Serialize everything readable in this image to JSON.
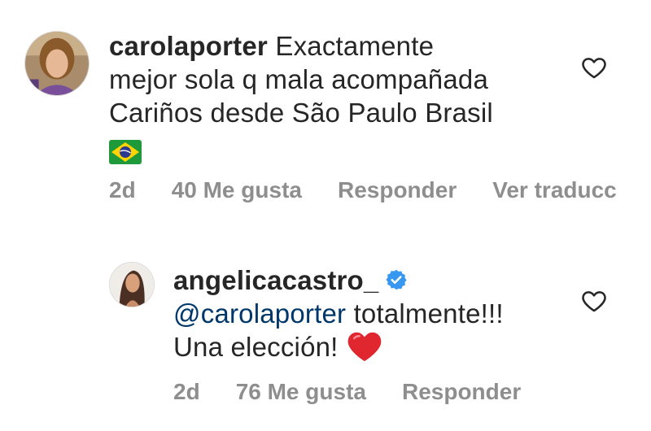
{
  "comments": [
    {
      "username": "carolaporter",
      "text_line1": "Exactamente",
      "text_line2": "mejor sola q mala acompañada",
      "text_line3": "Cariños desde São Paulo Brasil",
      "emoji": "brazil-flag",
      "time": "2d",
      "likes": "40 Me gusta",
      "reply": "Responder",
      "translate": "Ver traducc"
    },
    {
      "username": "angelicacastro_",
      "verified": true,
      "mention": "@carolaporter",
      "text_line1": "totalmente!!!",
      "text_line2": "Una elección!",
      "emoji": "red-heart",
      "time": "2d",
      "likes": "76 Me gusta",
      "reply": "Responder"
    }
  ],
  "colors": {
    "text": "#262626",
    "meta": "#8e8e8e",
    "mention": "#00376b",
    "verified": "#3897f0",
    "heart": "#ed4956"
  }
}
